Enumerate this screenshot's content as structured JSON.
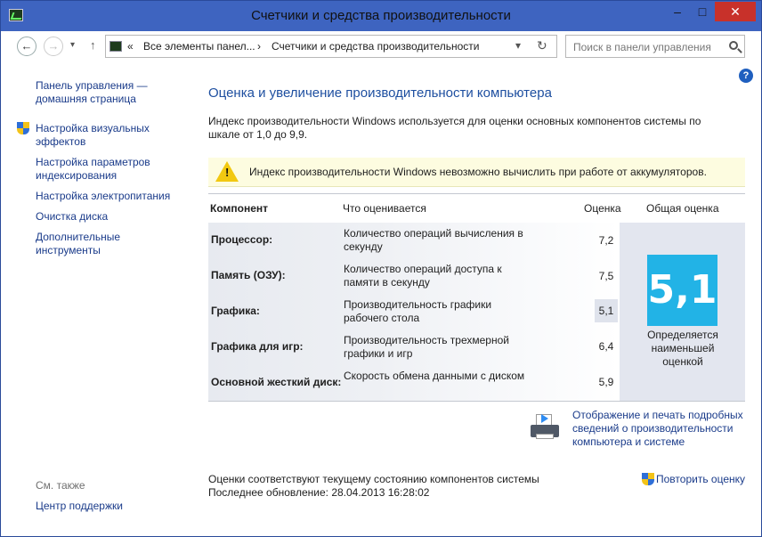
{
  "window": {
    "title": "Счетчики и средства производительности",
    "minimize": "–",
    "maximize": "□",
    "close": "✕"
  },
  "nav": {
    "back": "←",
    "forward": "→",
    "recent": "▾",
    "up": "↑",
    "address_overflow": "«",
    "breadcrumb_root": "Все элементы панел...",
    "breadcrumb_sep": "›",
    "breadcrumb_current": "Счетчики и средства производительности",
    "address_dropdown": "▾",
    "refresh": "↻",
    "search_placeholder": "Поиск в панели управления"
  },
  "help": "?",
  "sidebar": {
    "home": "Панель управления — домашняя страница",
    "items": [
      {
        "label": "Настройка визуальных эффектов",
        "shield": true
      },
      {
        "label": "Настройка параметров индексирования",
        "shield": false
      },
      {
        "label": "Настройка электропитания",
        "shield": false
      },
      {
        "label": "Очистка диска",
        "shield": false
      },
      {
        "label": "Дополнительные инструменты",
        "shield": false
      }
    ],
    "see_also": "См. также",
    "support": "Центр поддержки"
  },
  "main": {
    "title": "Оценка и увеличение производительности компьютера",
    "intro": "Индекс производительности Windows используется для оценки основных компонентов системы по шкале от 1,0 до 9,9.",
    "warning": "Индекс производительности Windows невозможно вычислить при работе от аккумуляторов.",
    "warning_mark": "!",
    "table": {
      "headers": {
        "component": "Компонент",
        "rated": "Что оценивается",
        "score": "Оценка",
        "base": "Общая оценка"
      },
      "rows": [
        {
          "name": "Процессор:",
          "desc": "Количество операций вычисления в секунду",
          "score": "7,2"
        },
        {
          "name": "Память (ОЗУ):",
          "desc": "Количество операций доступа к памяти в секунду",
          "score": "7,5"
        },
        {
          "name": "Графика:",
          "desc": "Производительность графики рабочего стола",
          "score": "5,1"
        },
        {
          "name": "Графика для игр:",
          "desc": "Производительность трехмерной графики и игр",
          "score": "6,4"
        },
        {
          "name": "Основной жесткий диск:",
          "desc": "Скорость обмена данными с диском",
          "score": "5,9"
        }
      ],
      "base_score": "5,1",
      "base_note": "Определяется наименьшей оценкой"
    },
    "print_link": "Отображение и печать подробных сведений о производительности компьютера и системе",
    "status_line1": "Оценки соответствуют текущему состоянию компонентов системы",
    "status_line2": "Последнее обновление: 28.04.2013 16:28:02",
    "rerun": "Повторить оценку"
  },
  "colors": {
    "titlebar": "#3e64c0",
    "close": "#c8312a",
    "link": "#1a3b8a",
    "heading": "#1e4fa0",
    "base_score_bg": "#22b3e6",
    "warning_bg": "#fdfce0"
  }
}
